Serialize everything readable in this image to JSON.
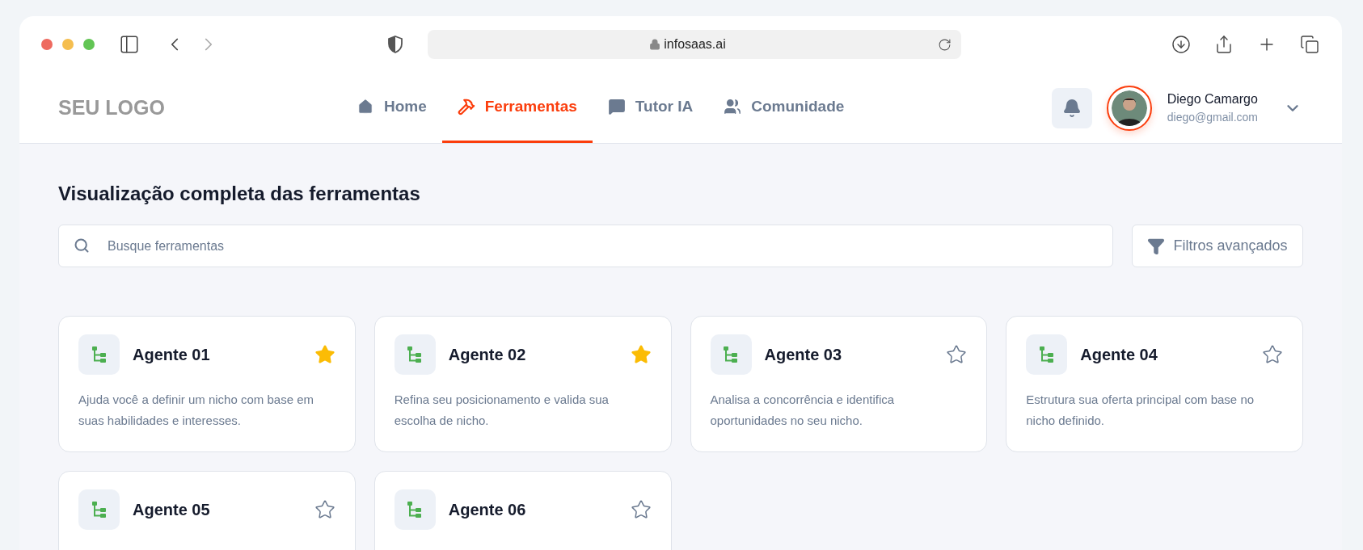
{
  "browser": {
    "url": "infosaas.ai"
  },
  "header": {
    "logo": "SEU LOGO",
    "nav": [
      {
        "label": "Home",
        "selected": false
      },
      {
        "label": "Ferramentas",
        "selected": true
      },
      {
        "label": "Tutor IA",
        "selected": false
      },
      {
        "label": "Comunidade",
        "selected": false
      }
    ],
    "user": {
      "name": "Diego Camargo",
      "email": "diego@gmail.com"
    }
  },
  "page": {
    "title": "Visualização completa das ferramentas",
    "search": {
      "placeholder": "Busque ferramentas"
    },
    "filters_button": "Filtros avançados"
  },
  "tools": [
    {
      "name": "Agente 01",
      "description": "Ajuda você a definir um nicho com base em suas habilidades e interesses.",
      "favorite": true
    },
    {
      "name": "Agente 02",
      "description": "Refina seu posicionamento e valida sua escolha de nicho.",
      "favorite": true
    },
    {
      "name": "Agente 03",
      "description": "Analisa a concorrência e identifica oportunidades no seu nicho.",
      "favorite": false
    },
    {
      "name": "Agente 04",
      "description": "Estrutura sua oferta principal com base no nicho definido.",
      "favorite": false
    },
    {
      "name": "Agente 05",
      "favorite": false
    },
    {
      "name": "Agente 06",
      "favorite": false
    }
  ]
}
